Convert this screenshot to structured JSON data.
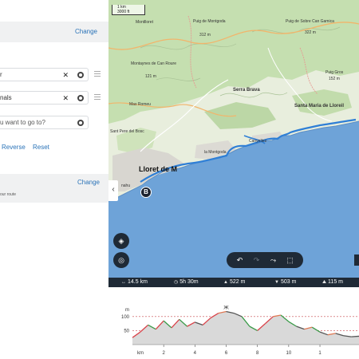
{
  "panel": {
    "change_label_top": "Change",
    "waypoints": [
      {
        "text": "r",
        "is_placeholder": false
      },
      {
        "text": "nals",
        "is_placeholder": false
      },
      {
        "text": "u want to go to?",
        "is_placeholder": true
      }
    ],
    "reverse_label": "Reverse",
    "reset_label": "Reset",
    "change_label_settings": "Change",
    "settings_hint": "our route"
  },
  "map": {
    "scale_km": "1 km",
    "scale_ft": "3000 ft",
    "labels": {
      "puig_montgoda": "Puig de Montgoda",
      "montlloret": "Montlloret",
      "puig_montgoda_elev": "312 m",
      "puig_sobre_ca_gamica": "Puig de Sobre Can Gamica",
      "elev_322": "322 m",
      "montaynes": "Montaynes de Can Roure",
      "elev_121": "121 m",
      "serra_brava": "Serra Brava",
      "puig_gros": "Puig Gros",
      "elev_152": "152 m",
      "mas_romeu": "Mas Romeu",
      "santa_maria": "Santa Maria de Lloreil",
      "sant_pere": "Sant Pere del Bosc",
      "la_montgoda": "la Montgoda",
      "canyelles": "Canyelles",
      "lloret": "Lloret de M",
      "nahu": "nahu"
    },
    "marker_label": "B",
    "collapse_icon": "‹"
  },
  "toolbar": {
    "undo_icon": "↶",
    "redo_icon": "↷",
    "route_icon": "⤳",
    "crop_icon": "⬚"
  },
  "stats": {
    "distance": "14.5 km",
    "duration": "5h 30m",
    "ascent": "522 m",
    "descent": "503 m",
    "max_elevation": "115 m"
  },
  "chart_data": {
    "type": "area",
    "title": "",
    "xlabel": "km",
    "ylabel": "m",
    "x_ticks": [
      "2",
      "4",
      "6",
      "8",
      "10",
      "1"
    ],
    "y_ticks": [
      "50",
      "100",
      "m"
    ],
    "ylim": [
      0,
      125
    ],
    "xlim": [
      0,
      14.5
    ],
    "grid": true,
    "peak_label": "Ж",
    "x": [
      0,
      0.5,
      1,
      1.5,
      2,
      2.5,
      3,
      3.5,
      4,
      4.5,
      5,
      5.5,
      6,
      6.5,
      7,
      7.5,
      8,
      8.5,
      9,
      9.5,
      10,
      10.5,
      11,
      11.5,
      12,
      12.5,
      13,
      13.5,
      14,
      14.5
    ],
    "series": [
      {
        "values": [
          25,
          45,
          70,
          55,
          85,
          60,
          90,
          65,
          80,
          70,
          95,
          112,
          118,
          112,
          100,
          65,
          50,
          75,
          100,
          105,
          82,
          65,
          55,
          62,
          45,
          35,
          40,
          32,
          28,
          30
        ]
      }
    ]
  }
}
